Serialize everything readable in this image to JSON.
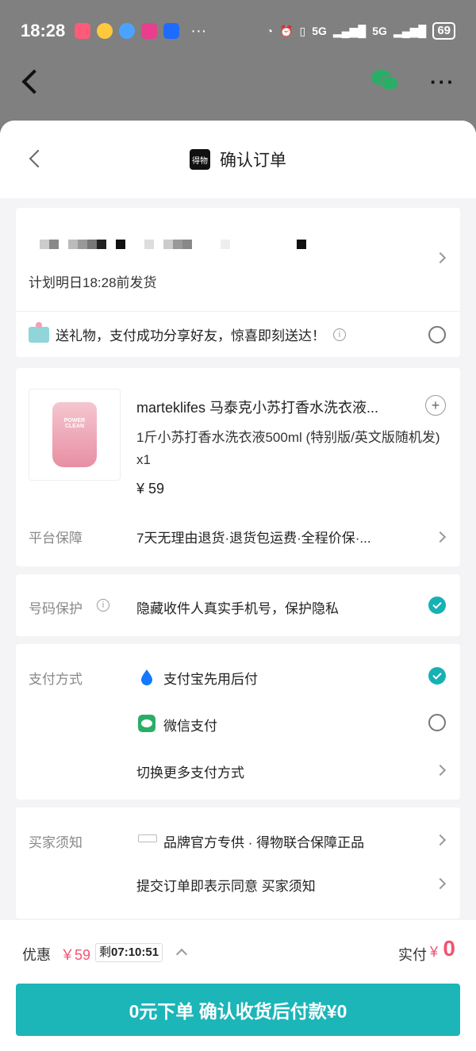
{
  "status_bar": {
    "time": "18:28",
    "network": "5G",
    "battery": "69"
  },
  "header": {
    "title": "确认订单",
    "logo_text": "得物"
  },
  "address": {
    "shipping_note": "计划明日18:28前发货"
  },
  "gift": {
    "text": "送礼物，支付成功分享好友，惊喜即刻送达！",
    "selected": false
  },
  "product": {
    "name": "marteklifes 马泰克小苏打香水洗衣液...",
    "spec": "1斤小苏打香水洗衣液500ml (特别版/英文版随机发) x1",
    "price": "¥ 59",
    "image_label": "POWER CLEAN"
  },
  "guarantee": {
    "label": "平台保障",
    "text": "7天无理由退货·退货包运费·全程价保·..."
  },
  "privacy": {
    "label": "号码保护",
    "text": "隐藏收件人真实手机号，保护隐私",
    "checked": true
  },
  "payment": {
    "label": "支付方式",
    "options": [
      {
        "name": "支付宝先用后付",
        "checked": true
      },
      {
        "name": "微信支付",
        "checked": false
      }
    ],
    "more": "切换更多支付方式"
  },
  "notice": {
    "label": "买家须知",
    "brand_text": "品牌官方专供 · 得物联合保障正品",
    "agreement": "提交订单即表示同意 买家须知"
  },
  "footer": {
    "discount_label": "优惠",
    "discount_amount": "￥59",
    "countdown_prefix": "剩",
    "countdown": "07:10:51",
    "paid_label": "实付",
    "paid_yen": "¥",
    "paid_amount": "0",
    "submit_label": "0元下单 确认收货后付款¥0"
  },
  "colors": {
    "accent": "#1cb5b8",
    "price_red": "#f05470",
    "alipay_blue": "#1677ff",
    "wechat_green": "#2aae67"
  }
}
